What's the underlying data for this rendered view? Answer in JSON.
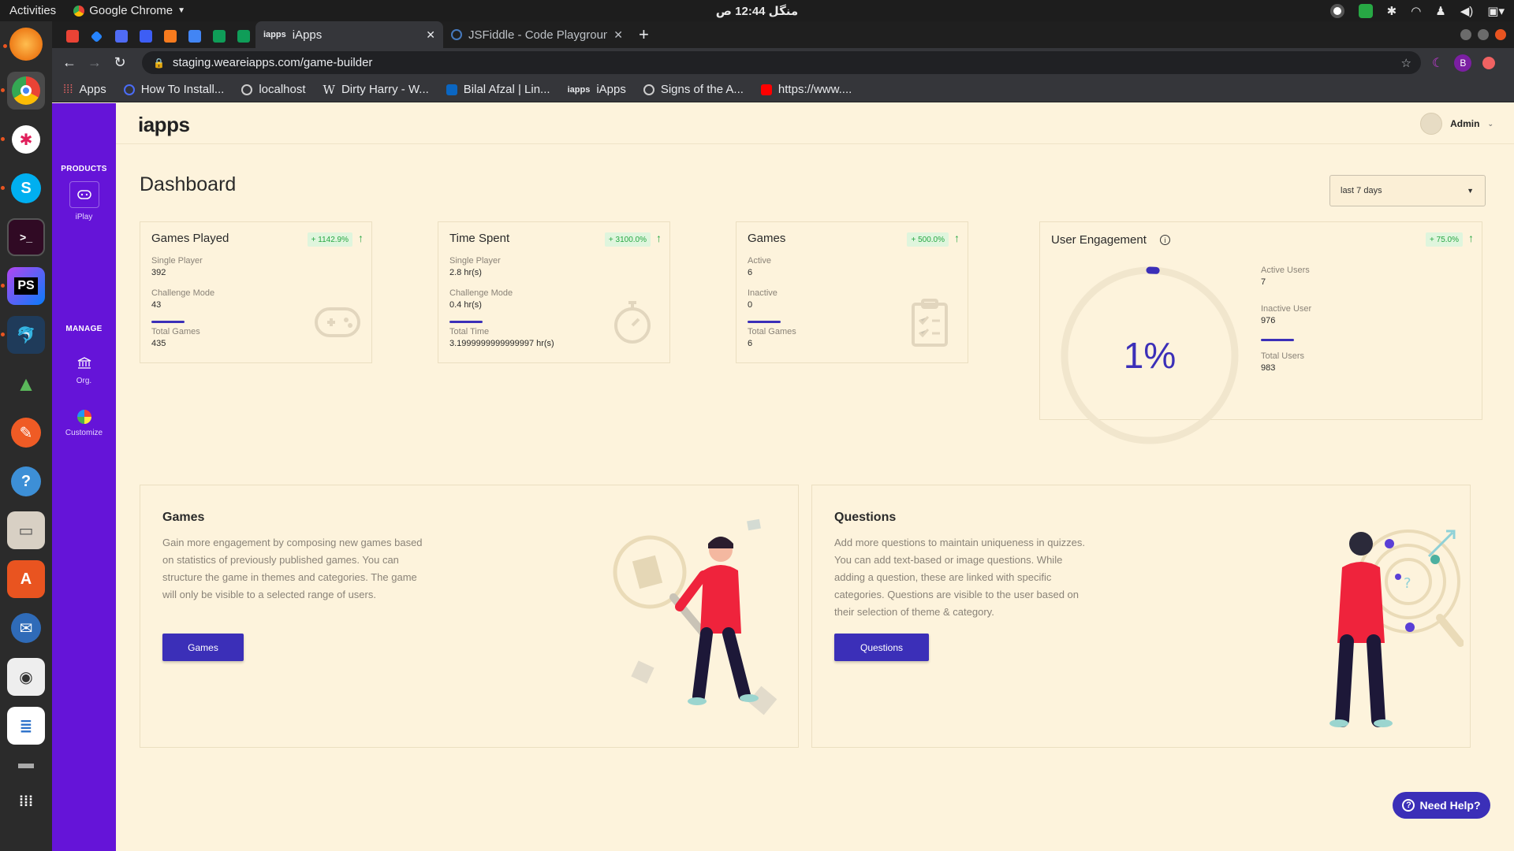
{
  "system": {
    "activities": "Activities",
    "app_name": "Google Chrome",
    "clock": "منگل 12:44 ص"
  },
  "chrome": {
    "tabs": [
      {
        "title": "iApps",
        "active": true
      },
      {
        "title": "JSFiddle - Code Playgroun",
        "active": false
      }
    ],
    "url": "staging.weareiapps.com/game-builder",
    "profile_initial": "B",
    "bookmarks": [
      "Apps",
      "How To Install...",
      "localhost",
      "Dirty Harry - W...",
      "Bilal Afzal | Lin...",
      "iApps",
      "Signs of the A...",
      "https://www...."
    ]
  },
  "sidebar": {
    "products_heading": "PRODUCTS",
    "products": [
      {
        "label": "iPlay",
        "icon": "gamepad-icon"
      }
    ],
    "manage_heading": "MANAGE",
    "manage": [
      {
        "label": "Org.",
        "icon": "bank-icon"
      },
      {
        "label": "Customize",
        "icon": "palette-icon"
      }
    ]
  },
  "header": {
    "logo": "iapps",
    "user_name": "Admin"
  },
  "dashboard": {
    "title": "Dashboard",
    "range": "last 7 days"
  },
  "cards": {
    "games_played": {
      "title": "Games Played",
      "badge": "+ 1142.9%",
      "l1": "Single Player",
      "v1": "392",
      "l2": "Challenge Mode",
      "v2": "43",
      "l3": "Total Games",
      "v3": "435"
    },
    "time_spent": {
      "title": "Time Spent",
      "badge": "+ 3100.0%",
      "l1": "Single Player",
      "v1": "2.8 hr(s)",
      "l2": "Challenge Mode",
      "v2": "0.4 hr(s)",
      "l3": "Total Time",
      "v3": "3.1999999999999997 hr(s)"
    },
    "games": {
      "title": "Games",
      "badge": "+ 500.0%",
      "l1": "Active",
      "v1": "6",
      "l2": "Inactive",
      "v2": "0",
      "l3": "Total Games",
      "v3": "6"
    },
    "engagement": {
      "title": "User Engagement",
      "badge": "+ 75.0%",
      "percent": "1%",
      "percent_value": 1,
      "l1": "Active Users",
      "v1": "7",
      "l2": "Inactive User",
      "v2": "976",
      "l3": "Total Users",
      "v3": "983"
    }
  },
  "promo": {
    "games": {
      "title": "Games",
      "desc": "Gain more engagement by composing new games based on statistics of previously published games. You can structure the game in themes and categories. The game will only be visible to a selected range of users.",
      "button": "Games"
    },
    "questions": {
      "title": "Questions",
      "desc": "Add more questions to maintain uniqueness in quizzes. You can add text-based or image questions. While adding a question, these are linked with specific categories. Questions are visible to the user based on their selection of theme & category.",
      "button": "Questions"
    }
  },
  "help": "Need Help?",
  "colors": {
    "accent": "#3b2fb8",
    "sidebar": "#6514d8",
    "background": "#fdf3dc",
    "positive": "#27a844"
  }
}
